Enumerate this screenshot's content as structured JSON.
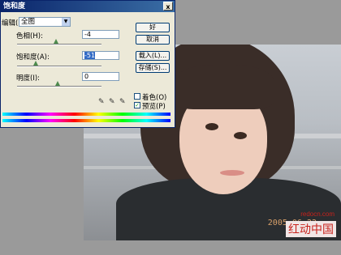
{
  "dialog": {
    "title": "饱和度",
    "close_label": "x",
    "edit_label": "编辑(E):",
    "edit_value": "全图",
    "hue_label": "色相(H):",
    "hue_value": "-4",
    "saturation_label": "饱和度(A):",
    "saturation_value": "-51",
    "lightness_label": "明度(I):",
    "lightness_value": "0",
    "buttons": {
      "ok": "好",
      "cancel": "取消",
      "load": "载入(L)...",
      "save": "存储(S)..."
    },
    "colorize_label": "着色(O)",
    "preview_label": "预览(P)",
    "colorize_checked": false,
    "preview_checked": true
  },
  "photo": {
    "timestamp": "2005 06 22",
    "watermark_url": "redocn.com",
    "watermark_cn": "红动中国"
  }
}
